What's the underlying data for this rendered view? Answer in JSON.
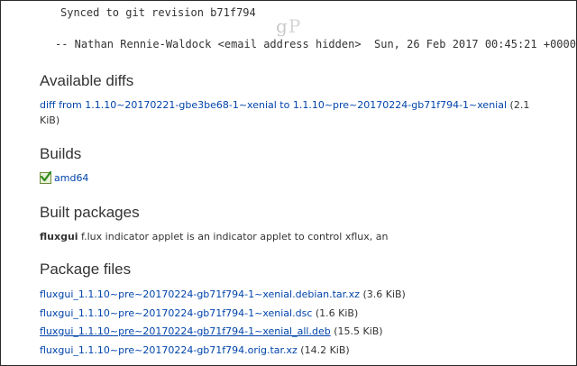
{
  "changelog": {
    "line1": "Synced to git revision b71f794",
    "line2": "-- Nathan Rennie-Waldock <email address hidden>  Sun, 26 Feb 2017 00:45:21 +0000",
    "watermark": "gP"
  },
  "available_diffs": {
    "heading": "Available diffs",
    "link_text": "diff from 1.1.10~20170221-gbe3be68-1~xenial to 1.1.10~pre~20170224-gb71f794-1~xenial",
    "size_part1": " (2.1",
    "size_part2": "KiB)"
  },
  "builds": {
    "heading": "Builds",
    "status_icon": "checkmark-icon",
    "arch": "amd64"
  },
  "built_packages": {
    "heading": "Built packages",
    "name": "fluxgui",
    "description": " f.lux indicator applet is an indicator applet to control xflux, an"
  },
  "package_files": {
    "heading": "Package files",
    "files": [
      {
        "name": "fluxgui_1.1.10~pre~20170224-gb71f794-1~xenial.debian.tar.xz",
        "size": " (3.6 KiB)"
      },
      {
        "name": "fluxgui_1.1.10~pre~20170224-gb71f794-1~xenial.dsc",
        "size": " (1.6 KiB)"
      },
      {
        "name": "fluxgui_1.1.10~pre~20170224-gb71f794-1~xenial_all.deb",
        "size": " (15.5 KiB)"
      },
      {
        "name": "fluxgui_1.1.10~pre~20170224-gb71f794.orig.tar.xz",
        "size": " (14.2 KiB)"
      }
    ]
  },
  "colors": {
    "link": "#0044aa",
    "text": "#333333",
    "check_green": "#2e8b1e"
  }
}
